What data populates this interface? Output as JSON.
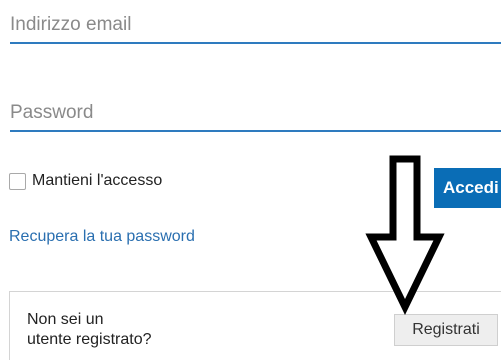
{
  "login_form": {
    "email_placeholder": "Indirizzo email",
    "password_placeholder": "Password",
    "remember_label": "Mantieni l'accesso",
    "login_button_label": "Accedi",
    "recover_link": "Recupera la tua password"
  },
  "register": {
    "prompt_line1": "Non sei un",
    "prompt_line2": "utente registrato?",
    "button_label": "Registrati"
  },
  "colors": {
    "accent": "#0a6db6",
    "link": "#2a6fb0",
    "field_underline": "#2e7bbf"
  },
  "icons": {
    "annotation_arrow": "down-arrow-icon"
  }
}
